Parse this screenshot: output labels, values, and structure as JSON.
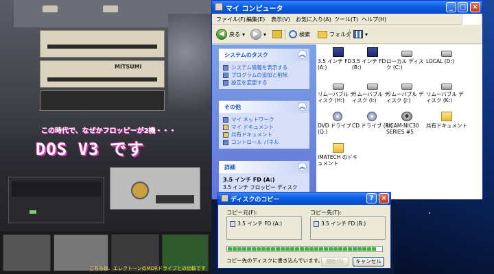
{
  "photo": {
    "caption": "この時代で、なぜかフロッピーが2機・・・",
    "title": "DOS V3 です",
    "drive_brand": "MITSUMI",
    "footnote": "こちらは、エレクトーンのMDRドライブとの比較です"
  },
  "explorer": {
    "title": "マイ コンピュータ",
    "menu": [
      "ファイル(F)",
      "編集(E)",
      "表示(V)",
      "お気に入り(A)",
      "ツール(T)",
      "ヘルプ(H)"
    ],
    "toolbar": {
      "back": "戻る",
      "search": "検索",
      "folders": "フォルダ"
    },
    "tasks": {
      "system_title": "システムのタスク",
      "system_links": [
        "システム情報を表示する",
        "プログラムの追加と削除",
        "設定を変更する"
      ],
      "other_title": "その他",
      "other_links": [
        "マイ ネットワーク",
        "マイ ドキュメント",
        "共有ドキュメント",
        "コントロール パネル"
      ],
      "details_title": "詳細",
      "details_name": "3.5 インチ FD (A:)",
      "details_type": "3.5 インチ フロッピー ディスク"
    },
    "items": [
      {
        "label": "3.5 インチ FD (A:)",
        "icon": "floppy-icon"
      },
      {
        "label": "3.5 インチ FD (B:)",
        "icon": "floppy-icon"
      },
      {
        "label": "ローカル ディスク (C:)",
        "icon": "hard-disk-icon"
      },
      {
        "label": "LOCAL (D:)",
        "icon": "hard-disk-icon"
      },
      {
        "label": "リムーバブル ディスク (H:)",
        "icon": "removable-disk-icon"
      },
      {
        "label": "リムーバブル ディスク (I:)",
        "icon": "removable-disk-icon"
      },
      {
        "label": "リムーバブル ディスク (J:)",
        "icon": "removable-disk-icon"
      },
      {
        "label": "リムーバブル ディスク (K:)",
        "icon": "removable-disk-icon"
      },
      {
        "label": "DVD ドライブ (Q:)",
        "icon": "dvd-drive-icon"
      },
      {
        "label": "CD ドライブ (R:)",
        "icon": "cd-drive-icon"
      },
      {
        "label": "UCAM-NIC30 SERIES #5",
        "icon": "webcam-icon"
      },
      {
        "label": "共有ドキュメント",
        "icon": "folder-icon"
      },
      {
        "label": "IMATECH のドキュメント",
        "icon": "folder-icon"
      }
    ]
  },
  "copy_dialog": {
    "title": "ディスクのコピー",
    "source_label": "コピー元(F):",
    "dest_label": "コピー先(T):",
    "source_value": "3.5 インチ FD (A:)",
    "dest_value": "3.5 インチ FD (B:)",
    "progress_fraction": 0.97,
    "status": "コピー先のディスクに書き込んでいます。",
    "start_button": "開始(S)",
    "cancel_button": "キャンセル"
  },
  "colors": {
    "xp_title_blue": "#0548c8",
    "task_pane": "#7ba2e7",
    "link_blue": "#215dc6"
  }
}
